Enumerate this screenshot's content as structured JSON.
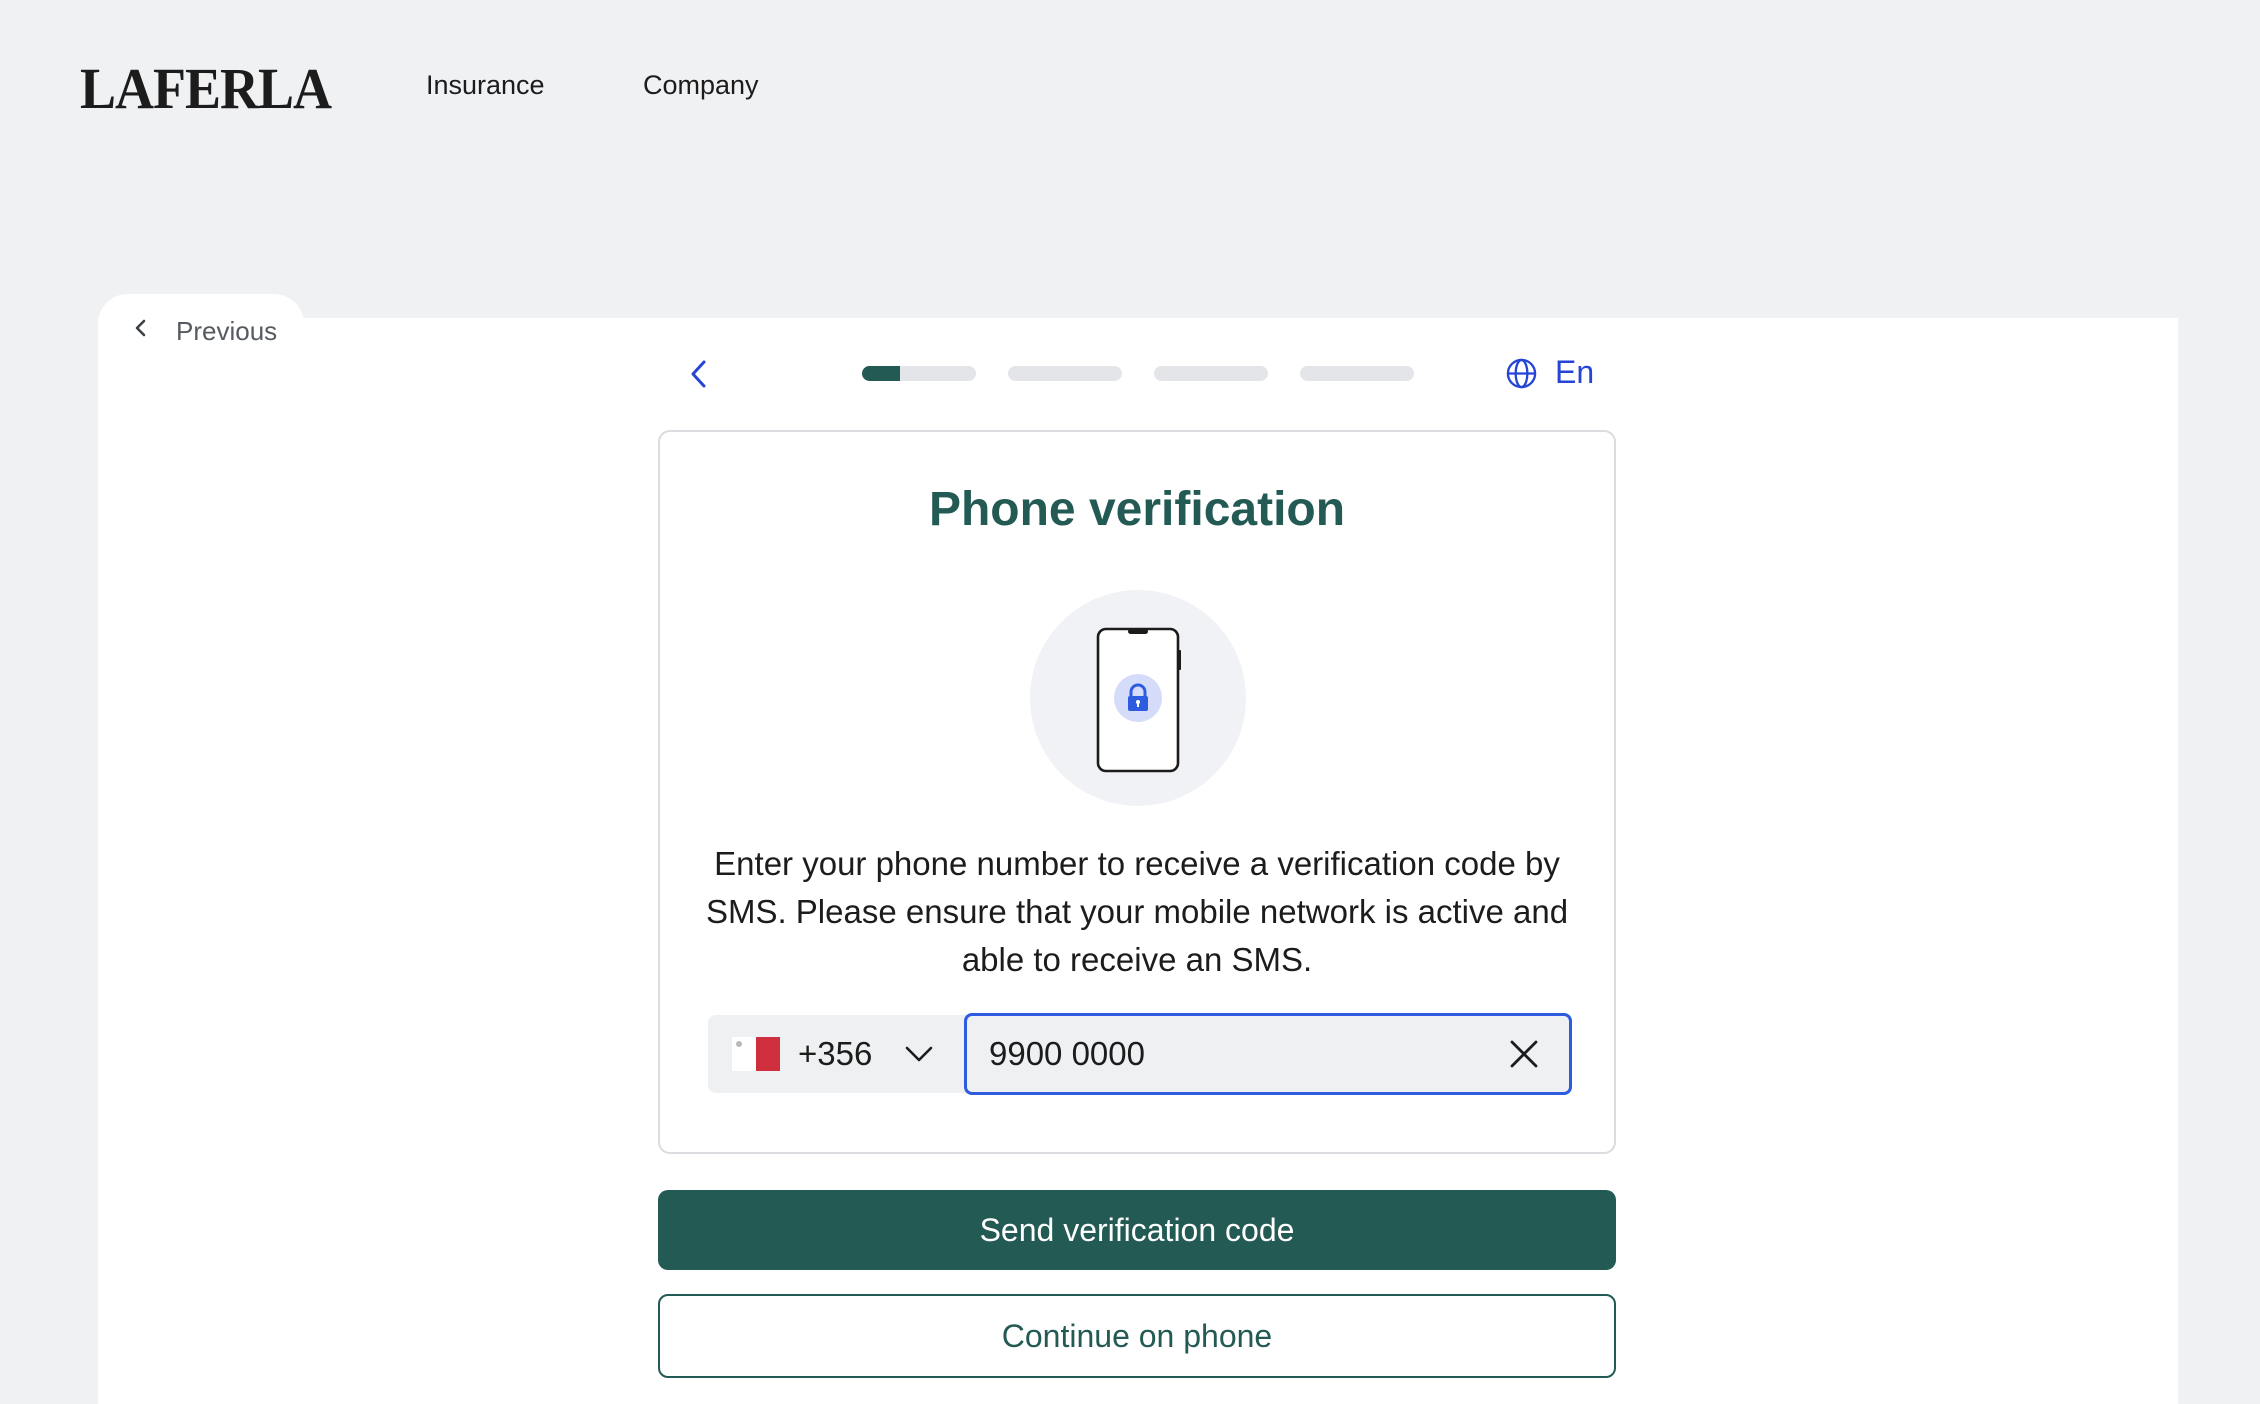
{
  "header": {
    "logo_text": "LAFERLA",
    "nav": [
      {
        "label": "Insurance"
      },
      {
        "label": "Company"
      }
    ]
  },
  "previous": {
    "label": "Previous",
    "icon": "chevron-left-icon"
  },
  "stepper": {
    "back_icon": "chevron-left-icon",
    "total_steps": 4,
    "current_step": 1,
    "current_step_progress": 0.33,
    "language": "En",
    "language_icon": "globe-icon"
  },
  "card": {
    "title": "Phone verification",
    "illustration_icon": "phone-lock-icon",
    "description": "Enter your phone number to receive a verification code by SMS. Please ensure that your mobile network is active and able to receive an SMS.",
    "country": {
      "flag_icon": "malta-flag-icon",
      "dial_code": "+356"
    },
    "phone": {
      "value": "9900 0000",
      "clear_icon": "close-icon"
    }
  },
  "actions": {
    "send_label": "Send verification code",
    "continue_label": "Continue on phone"
  },
  "colors": {
    "brand": "#235a54",
    "accent": "#2645d6",
    "page_background": "#f0f1f3"
  }
}
